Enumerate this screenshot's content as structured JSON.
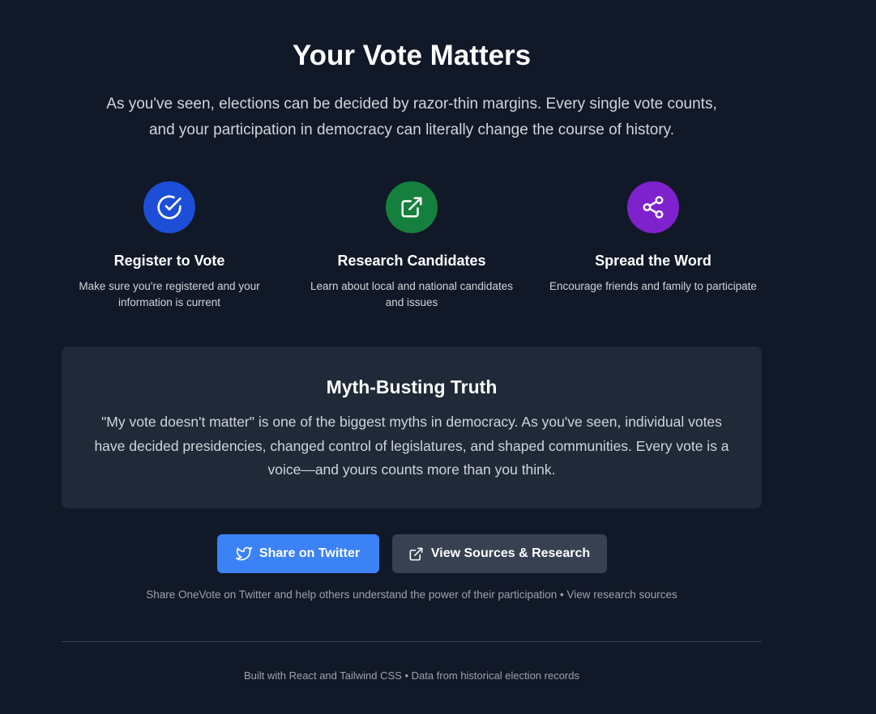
{
  "header": {
    "title": "Your Vote Matters",
    "intro": "As you've seen, elections can be decided by razor-thin margins. Every single vote counts, and your participation in democracy can literally change the course of history."
  },
  "features": [
    {
      "title": "Register to Vote",
      "description": "Make sure you're registered and your information is current",
      "icon": "check-circle-icon",
      "color": "#1d4ed8"
    },
    {
      "title": "Research Candidates",
      "description": "Learn about local and national candidates and issues",
      "icon": "external-link-icon",
      "color": "#15803d"
    },
    {
      "title": "Spread the Word",
      "description": "Encourage friends and family to participate",
      "icon": "share-icon",
      "color": "#7e22ce"
    }
  ],
  "myth": {
    "title": "Myth-Busting Truth",
    "text": "\"My vote doesn't matter\" is one of the biggest myths in democracy. As you've seen, individual votes have decided presidencies, changed control of legislatures, and shaped communities. Every vote is a voice—and yours counts more than you think."
  },
  "actions": {
    "twitter_label": "Share on Twitter",
    "twitter_icon": "twitter-icon",
    "sources_label": "View Sources & Research",
    "sources_icon": "external-link-icon",
    "helper_text": "Share OneVote on Twitter and help others understand the power of their participation • View research sources"
  },
  "footer": {
    "text": "Built with React and Tailwind CSS • Data from historical election records"
  },
  "colors": {
    "background": "#111827",
    "card": "#1f2937",
    "twitter_button": "#3b82f6",
    "sources_button": "#374151"
  }
}
